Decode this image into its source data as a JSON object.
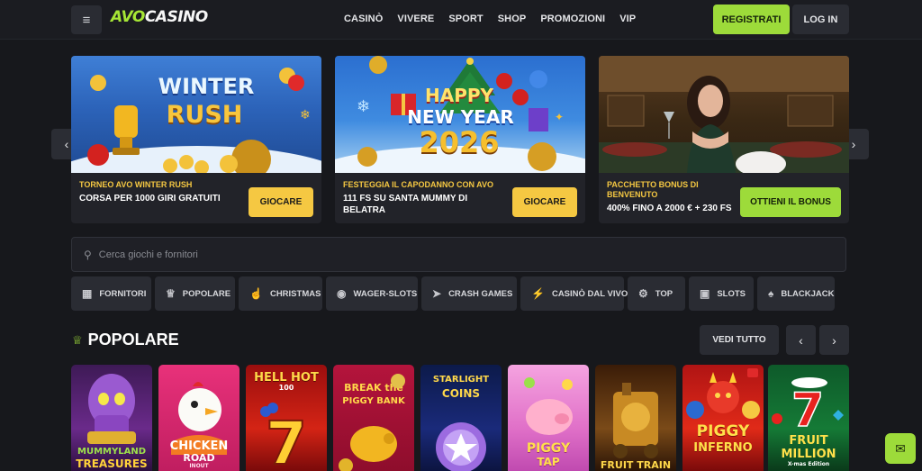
{
  "header": {
    "logo_part1": "AVO",
    "logo_part2": "CASINO",
    "nav": [
      "CASINÒ",
      "VIVERE",
      "SPORT",
      "SHOP",
      "PROMOZIONI",
      "VIP"
    ],
    "register_label": "REGISTRATI",
    "login_label": "LOG IN",
    "menu_icon": "menu-icon"
  },
  "promos": [
    {
      "art_line1": "WINTER",
      "art_line2": "RUSH",
      "subtitle": "TORNEO AVO WINTER RUSH",
      "title": "CORSA PER 1000 GIRI GRATUITI",
      "cta": "GIOCARE"
    },
    {
      "art_line1": "HAPPY",
      "art_line2": "NEW YEAR",
      "art_line3": "2026",
      "subtitle": "FESTEGGIA IL CAPODANNO CON AVO",
      "title": "111 FS SU SANTA MUMMY DI BELATRA",
      "cta": "GIOCARE"
    },
    {
      "subtitle": "PACCHETTO BONUS DI BENVENUTO",
      "title": "400% FINO A 2000 € + 230 FS",
      "cta": "OTTIENI IL BONUS"
    }
  ],
  "search": {
    "placeholder": "Cerca giochi e fornitori"
  },
  "categories": [
    {
      "label": "FORNITORI",
      "icon": "grid-icon"
    },
    {
      "label": "POPOLARE",
      "icon": "crown-icon"
    },
    {
      "label": "CHRISTMAS",
      "icon": "hand-icon"
    },
    {
      "label": "WAGER-SLOTS",
      "icon": "chips-icon"
    },
    {
      "label": "CRASH GAMES",
      "icon": "rocket-icon"
    },
    {
      "label": "CASINÒ DAL VIVO",
      "icon": "lightning-icon"
    },
    {
      "label": "TOP",
      "icon": "gear-icon"
    },
    {
      "label": "SLOTS",
      "icon": "slots-icon"
    },
    {
      "label": "BLACKJACK",
      "icon": "cards-icon"
    }
  ],
  "section": {
    "title": "POPOLARE",
    "see_all": "VEDI TUTTO"
  },
  "games": [
    {
      "line1": "MUMMYLAND",
      "line2": "TREASURES"
    },
    {
      "line1": "CHICKEN",
      "line2": "ROAD",
      "line3": "INOUT"
    },
    {
      "line1": "HELL HOT",
      "line2": "100"
    },
    {
      "line1": "BREAK the",
      "line2": "PIGGY BANK"
    },
    {
      "line1": "STARLIGHT",
      "line2": "COINS"
    },
    {
      "line1": "PIGGY",
      "line2": "TAP"
    },
    {
      "line1": "FRUIT TRAIN",
      "line2": ""
    },
    {
      "line1": "PIGGY",
      "line2": "INFERNO"
    },
    {
      "line1": "FRUIT",
      "line2": "MILLION",
      "line3": "X-mas Edition"
    }
  ],
  "colors": {
    "accent": "#9ddb3a",
    "yellow": "#f5c842",
    "bg": "#17181c"
  }
}
